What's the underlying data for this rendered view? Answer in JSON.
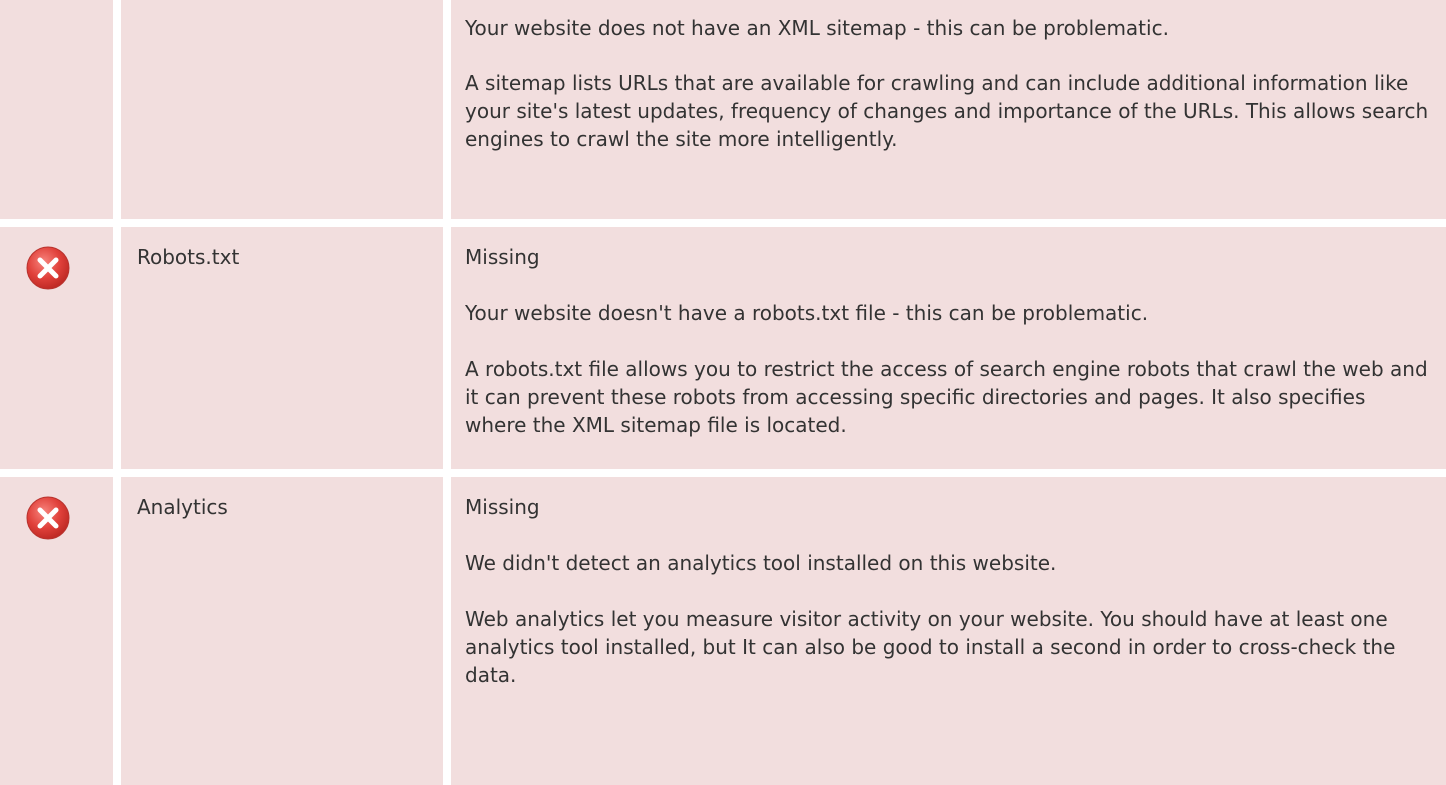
{
  "sitemap": {
    "paragraphs": [
      "Your website does not have an XML sitemap - this can be problematic.",
      "A sitemap lists URLs that are available for crawling and can include additional information like your site's latest updates, frequency of changes and importance of the URLs. This allows search engines to crawl the site more intelligently."
    ]
  },
  "robots": {
    "label": "Robots.txt",
    "status": "Missing",
    "paragraphs": [
      "Your website doesn't have a robots.txt file - this can be problematic.",
      "A robots.txt file allows you to restrict the access of search engine robots that crawl the web and it can prevent these robots from accessing specific directories and pages. It also specifies where the XML sitemap file is located."
    ]
  },
  "analytics": {
    "label": "Analytics",
    "status": "Missing",
    "paragraphs": [
      "We didn't detect an analytics tool installed on this website.",
      "Web analytics let you measure visitor activity on your website. You should have at least one analytics tool installed, but It can also be good to install a second in order to cross-check the data."
    ]
  },
  "icons": {
    "error": "error-x-icon"
  },
  "colors": {
    "row_background": "#f2dede",
    "error_red": "#e0403a",
    "text": "#333333"
  }
}
